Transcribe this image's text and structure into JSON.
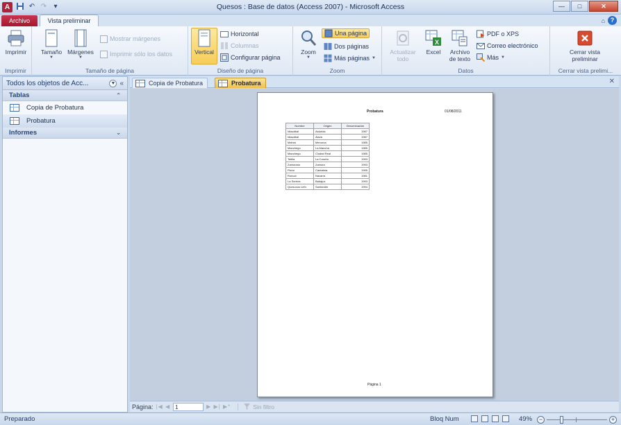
{
  "window": {
    "title": "Quesos : Base de datos (Access 2007)  -  Microsoft Access",
    "app_icon_letter": "A",
    "controls": {
      "minimize": "—",
      "maximize": "□",
      "close": "✕"
    }
  },
  "tabs": {
    "file": "Archivo",
    "active": "Vista preliminar"
  },
  "ribbon": {
    "groups": {
      "imprimir": {
        "label": "Imprimir",
        "print": "Imprimir"
      },
      "tamano": {
        "label": "Tamaño de página",
        "size": "Tamaño",
        "margins": "Márgenes",
        "show_margins": "Mostrar márgenes",
        "print_data_only": "Imprimir sólo los datos"
      },
      "diseno": {
        "label": "Diseño de página",
        "vertical": "Vertical",
        "horizontal": "Horizontal",
        "columnas": "Columnas",
        "configurar": "Configurar página"
      },
      "zoom": {
        "label": "Zoom",
        "zoom": "Zoom",
        "una_pagina": "Una página",
        "dos_paginas": "Dos páginas",
        "mas_paginas": "Más páginas"
      },
      "datos": {
        "label": "Datos",
        "actualizar_1": "Actualizar",
        "actualizar_2": "todo",
        "excel": "Excel",
        "archivo_1": "Archivo",
        "archivo_2": "de texto",
        "pdf": "PDF o XPS",
        "correo": "Correo electrónico",
        "mas": "Más"
      },
      "cerrar": {
        "label": "Cerrar vista prelimi...",
        "line1": "Cerrar vista",
        "line2": "preliminar"
      }
    }
  },
  "nav_pane": {
    "title": "Todos los objetos de Acc...",
    "groups": [
      {
        "label": "Tablas",
        "items": [
          "Copia de Probatura",
          "Probatura"
        ]
      },
      {
        "label": "Informes",
        "items": []
      }
    ]
  },
  "document_tabs": [
    {
      "label": "Copia de Probatura",
      "active": false
    },
    {
      "label": "Probatura",
      "active": true
    }
  ],
  "report": {
    "title": "Probatura",
    "date": "01/08/2011",
    "footer": "Página 1",
    "columns": [
      "Nombre",
      "Origen",
      "Denominación"
    ],
    "rows": [
      [
        "Idiazábal",
        "Asturias",
        "1987"
      ],
      [
        "Idiazábal",
        "Álava",
        "1987"
      ],
      [
        "Mahón",
        "Menorca",
        "1985"
      ],
      [
        "Manchego",
        "La Mancha",
        "1985"
      ],
      [
        "Manchego",
        "Ciudad Real",
        "1985"
      ],
      [
        "Tetilla",
        "La Coruña",
        "1993"
      ],
      [
        "Zamorano",
        "Zamora",
        "1993"
      ],
      [
        "Picón",
        "Cantabria",
        "1995"
      ],
      [
        "Roncal",
        "Navarra",
        "1981"
      ],
      [
        "La Serena",
        "Badajoz",
        "1993"
      ],
      [
        "Quesucos Liéb.",
        "Santander",
        "1994"
      ]
    ]
  },
  "record_nav": {
    "label": "Página:",
    "value": "1",
    "filter": "Sin filtro"
  },
  "status_bar": {
    "left": "Preparado",
    "bloq_num": "Bloq Num",
    "zoom": "49%"
  },
  "zoom_level": 0.49,
  "colors": {
    "file_tab": "#b01e36",
    "accent_selected": "#f6c95a",
    "close_red": "#c6452b"
  }
}
